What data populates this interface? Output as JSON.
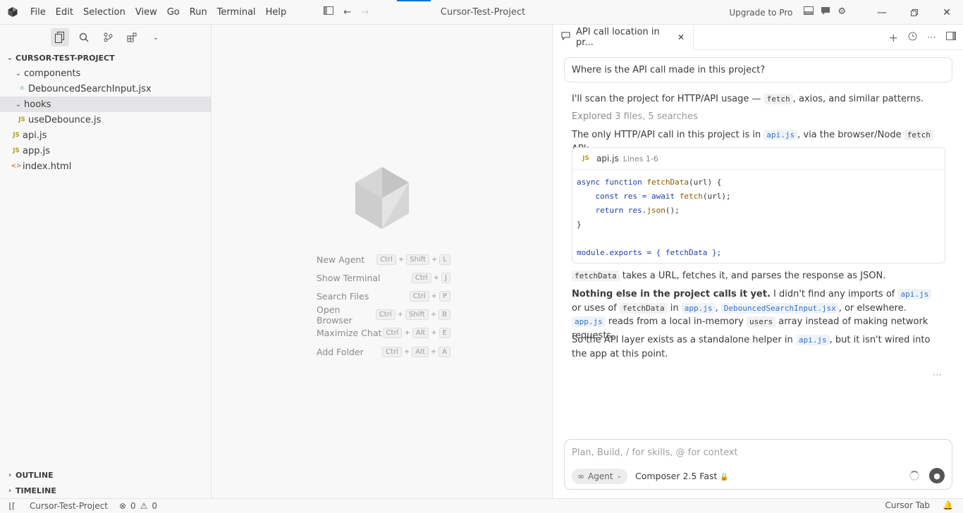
{
  "menu": [
    "File",
    "Edit",
    "Selection",
    "View",
    "Go",
    "Run",
    "Terminal",
    "Help"
  ],
  "window_title": "Cursor-Test-Project",
  "upgrade_label": "Upgrade to Pro",
  "explorer": {
    "root": "CURSOR-TEST-PROJECT",
    "items": [
      {
        "label": "components",
        "type": "folder",
        "level": 1
      },
      {
        "label": "DebouncedSearchInput.jsx",
        "type": "react",
        "level": 2
      },
      {
        "label": "hooks",
        "type": "folder",
        "level": 1
      },
      {
        "label": "useDebounce.js",
        "type": "js",
        "level": 2
      },
      {
        "label": "api.js",
        "type": "js",
        "level": 1
      },
      {
        "label": "app.js",
        "type": "js",
        "level": 1
      },
      {
        "label": "index.html",
        "type": "html",
        "level": 1
      }
    ],
    "outline": "OUTLINE",
    "timeline": "TIMELINE"
  },
  "shortcuts": [
    {
      "label": "New Agent",
      "keys": [
        "Ctrl",
        "Shift",
        "L"
      ]
    },
    {
      "label": "Show Terminal",
      "keys": [
        "Ctrl",
        "J"
      ]
    },
    {
      "label": "Search Files",
      "keys": [
        "Ctrl",
        "P"
      ]
    },
    {
      "label": "Open Browser",
      "keys": [
        "Ctrl",
        "Shift",
        "B"
      ]
    },
    {
      "label": "Maximize Chat",
      "keys": [
        "Ctrl",
        "Alt",
        "E"
      ]
    },
    {
      "label": "Add Folder",
      "keys": [
        "Ctrl",
        "Alt",
        "A"
      ]
    }
  ],
  "chat": {
    "tab_title": "API call location in pr...",
    "question": "Where is the API call made in this project?",
    "m1a": "I'll scan the project for HTTP/API usage — ",
    "m1code": "fetch",
    "m1b": ", axios, and similar patterns.",
    "explored_a": "Explored",
    "explored_b": " 3 files, 5 searches",
    "m2a": "The only HTTP/API call in this project is in ",
    "m2code1": "api.js",
    "m2b": ", via the browser/Node ",
    "m2code2": "fetch",
    "m2c": " API:",
    "code_file": "api.js",
    "code_lines": "Lines 1-6",
    "code_l1a": "async function ",
    "code_l1b": "fetchData",
    "code_l1c": "(url) {",
    "code_l2a": "    const res = await ",
    "code_l2b": "fetch",
    "code_l2c": "(url);",
    "code_l3a": "    return res.",
    "code_l3b": "json",
    "code_l3c": "();",
    "code_l4": "}",
    "code_l6": "module.exports = { fetchData };",
    "m3code": "fetchData",
    "m3": " takes a URL, fetches it, and parses the response as JSON.",
    "m4bold": "Nothing else in the project calls it yet.",
    "m4a": " I didn't find any imports of ",
    "m4code1": "api.js",
    "m4b": " or uses of ",
    "m4code2": "fetchData",
    "m4c": " in ",
    "m4code3": "app.js",
    "m4d": ", ",
    "m4code4": "DebouncedSearchInput.jsx",
    "m4e": ", or elsewhere. ",
    "m4code5": "app.js",
    "m4f": " reads from a local in-memory ",
    "m4code6": "users",
    "m4g": " array instead of making network requests.",
    "m5a": "So the API layer exists as a standalone helper in ",
    "m5code": "api.js",
    "m5b": ", but it isn't wired into the app at this point.",
    "input_placeholder": "Plan, Build, / for skills, @ for context",
    "agent_label": "Agent",
    "model_label": "Composer 2.5 Fast"
  },
  "status": {
    "project": "Cursor-Test-Project",
    "errors": "0",
    "warnings": "0",
    "cursor_tab": "Cursor Tab"
  }
}
